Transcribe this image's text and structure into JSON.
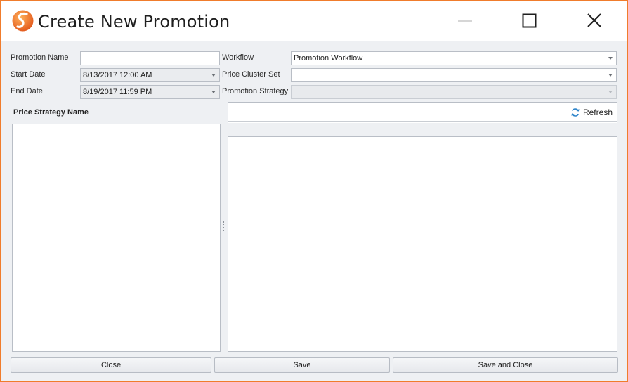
{
  "window": {
    "title": "Create New Promotion",
    "accent_color": "#f07c2c",
    "icons": {
      "app": "app-logo-icon",
      "minimize": "minimize-icon",
      "maximize": "maximize-icon",
      "close": "close-icon"
    }
  },
  "form": {
    "promotion_name": {
      "label": "Promotion Name",
      "value": ""
    },
    "start_date": {
      "label": "Start Date",
      "value": "8/13/2017 12:00 AM"
    },
    "end_date": {
      "label": "End Date",
      "value": "8/19/2017 11:59 PM"
    },
    "workflow": {
      "label": "Workflow",
      "value": "Promotion Workflow"
    },
    "price_cluster_set": {
      "label": "Price Cluster Set",
      "value": ""
    },
    "promotion_strategy": {
      "label": "Promotion Strategy",
      "value": ""
    }
  },
  "price_strategy": {
    "title": "Price Strategy Name",
    "items": []
  },
  "grid": {
    "refresh_label": "Refresh",
    "refresh_icon": "refresh-icon",
    "columns": [],
    "rows": []
  },
  "buttons": {
    "close": "Close",
    "save": "Save",
    "save_and_close": "Save and Close"
  }
}
